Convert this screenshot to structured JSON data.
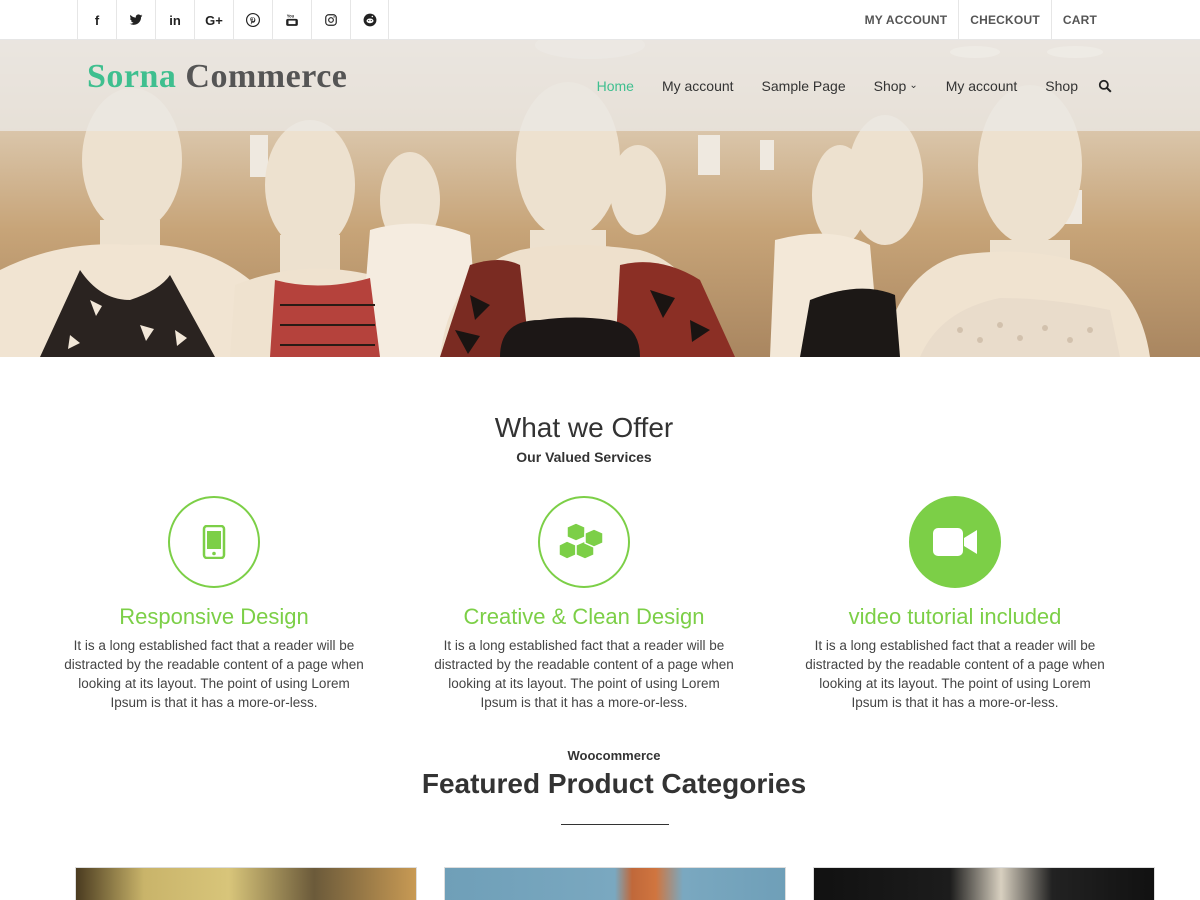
{
  "topbar": {
    "socials": [
      {
        "icon": "facebook-icon",
        "glyph": "f"
      },
      {
        "icon": "twitter-icon",
        "glyph": ""
      },
      {
        "icon": "linkedin-icon",
        "glyph": "in"
      },
      {
        "icon": "google-plus-icon",
        "glyph": "G+"
      },
      {
        "icon": "pinterest-icon",
        "glyph": ""
      },
      {
        "icon": "youtube-icon",
        "glyph": ""
      },
      {
        "icon": "instagram-icon",
        "glyph": ""
      },
      {
        "icon": "reddit-icon",
        "glyph": ""
      }
    ],
    "links": [
      "MY ACCOUNT",
      "CHECKOUT",
      "CART"
    ]
  },
  "header": {
    "logo_word1": "Sorna",
    "logo_word2": "Commerce",
    "nav": [
      "Home",
      "My account",
      "Sample Page",
      "Shop",
      "My account",
      "Shop"
    ],
    "active_nav": "Home"
  },
  "offer": {
    "title": "What we Offer",
    "subtitle": "Our Valued Services",
    "services": [
      {
        "icon": "mobile-phone-icon",
        "title": "Responsive Design",
        "text": "It is a long established fact that a reader will be distracted by the readable content of a page when looking at its layout. The point of using Lorem Ipsum is that it has a more-or-less."
      },
      {
        "icon": "cubes-icon",
        "title": "Creative & Clean Design",
        "text": "It is a long established fact that a reader will be distracted by the readable content of a page when looking at its layout. The point of using Lorem Ipsum is that it has a more-or-less."
      },
      {
        "icon": "video-camera-icon",
        "title": "video tutorial included",
        "text": "It is a long established fact that a reader will be distracted by the readable content of a page when looking at its layout. The point of using Lorem Ipsum is that it has a more-or-less."
      }
    ]
  },
  "featured": {
    "label": "Woocommerce",
    "title": "Featured Product Categories"
  },
  "colors": {
    "accent": "#7ccf47",
    "brand_green": "#3fbf8f"
  }
}
